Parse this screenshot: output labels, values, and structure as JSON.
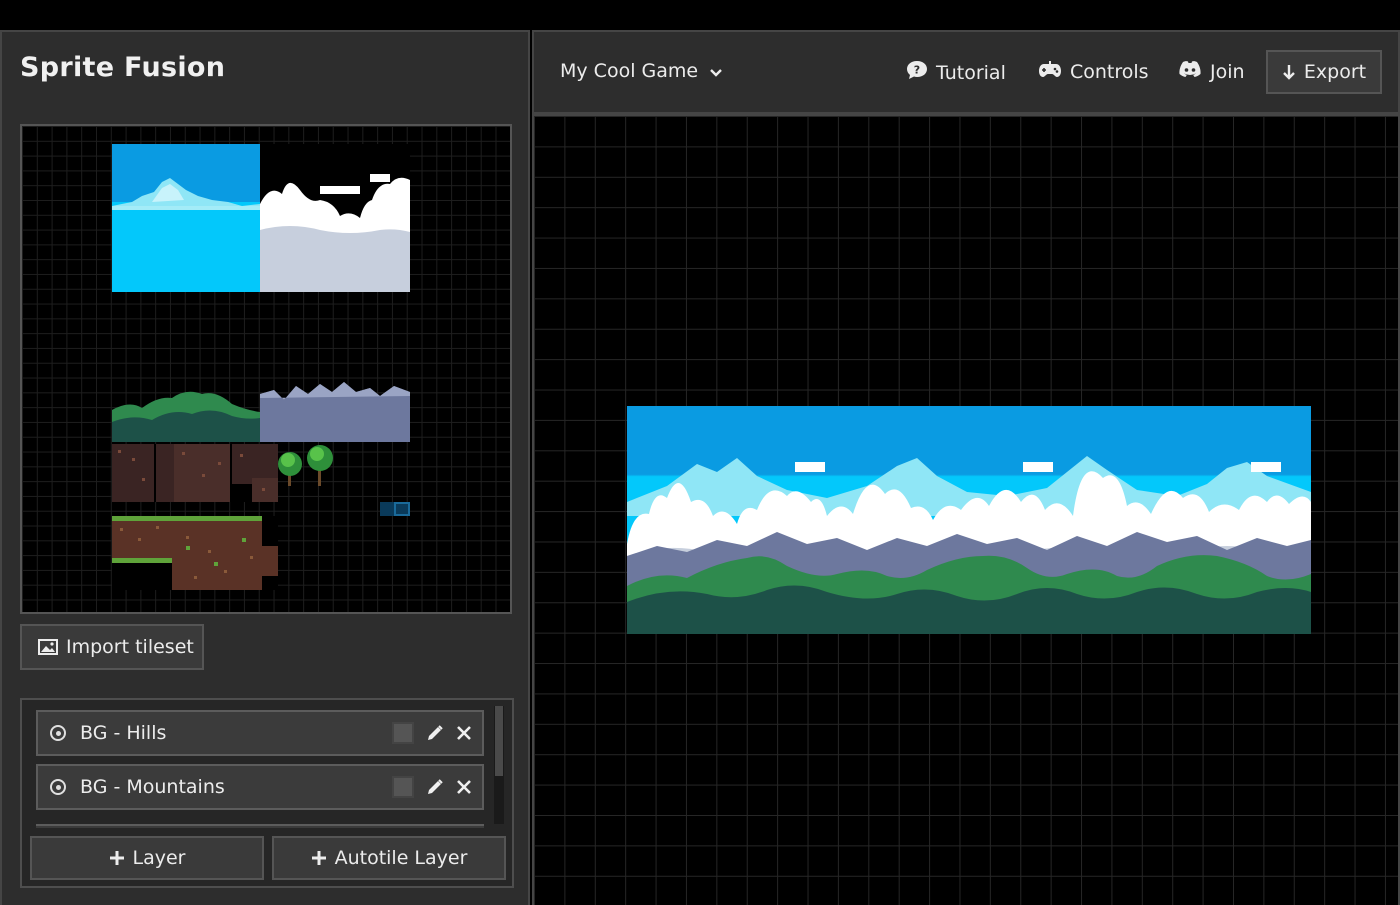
{
  "app": {
    "title": "Sprite Fusion"
  },
  "tileset": {
    "import_label": "Import tileset"
  },
  "layers": {
    "items": [
      {
        "label": "BG - Hills"
      },
      {
        "label": "BG - Mountains"
      }
    ],
    "add_layer_label": "Layer",
    "add_autotile_label": "Autotile Layer"
  },
  "topbar": {
    "project_name": "My Cool Game",
    "nav": {
      "tutorial": "Tutorial",
      "controls": "Controls",
      "join": "Join",
      "export": "Export"
    }
  },
  "icons": {
    "project_dropdown": "chevron-down-icon",
    "tutorial": "help-bubble-icon",
    "controls": "gamepad-icon",
    "join": "discord-icon",
    "export": "arrow-down-icon",
    "import": "image-icon",
    "layer_visibility": "eye-icon",
    "layer_edit": "pencil-icon",
    "layer_delete": "close-icon",
    "add": "plus-icon"
  },
  "colors": {
    "panel_bg": "#2d2d2d",
    "border": "#454545",
    "canvas_bg": "#000000",
    "sky_top": "#0a9be2",
    "sky_light": "#03c8fb",
    "cloud": "#ffffff",
    "mountain": "#6d789e",
    "hill": "#2f8a4e",
    "hill_dark": "#1d5148"
  }
}
